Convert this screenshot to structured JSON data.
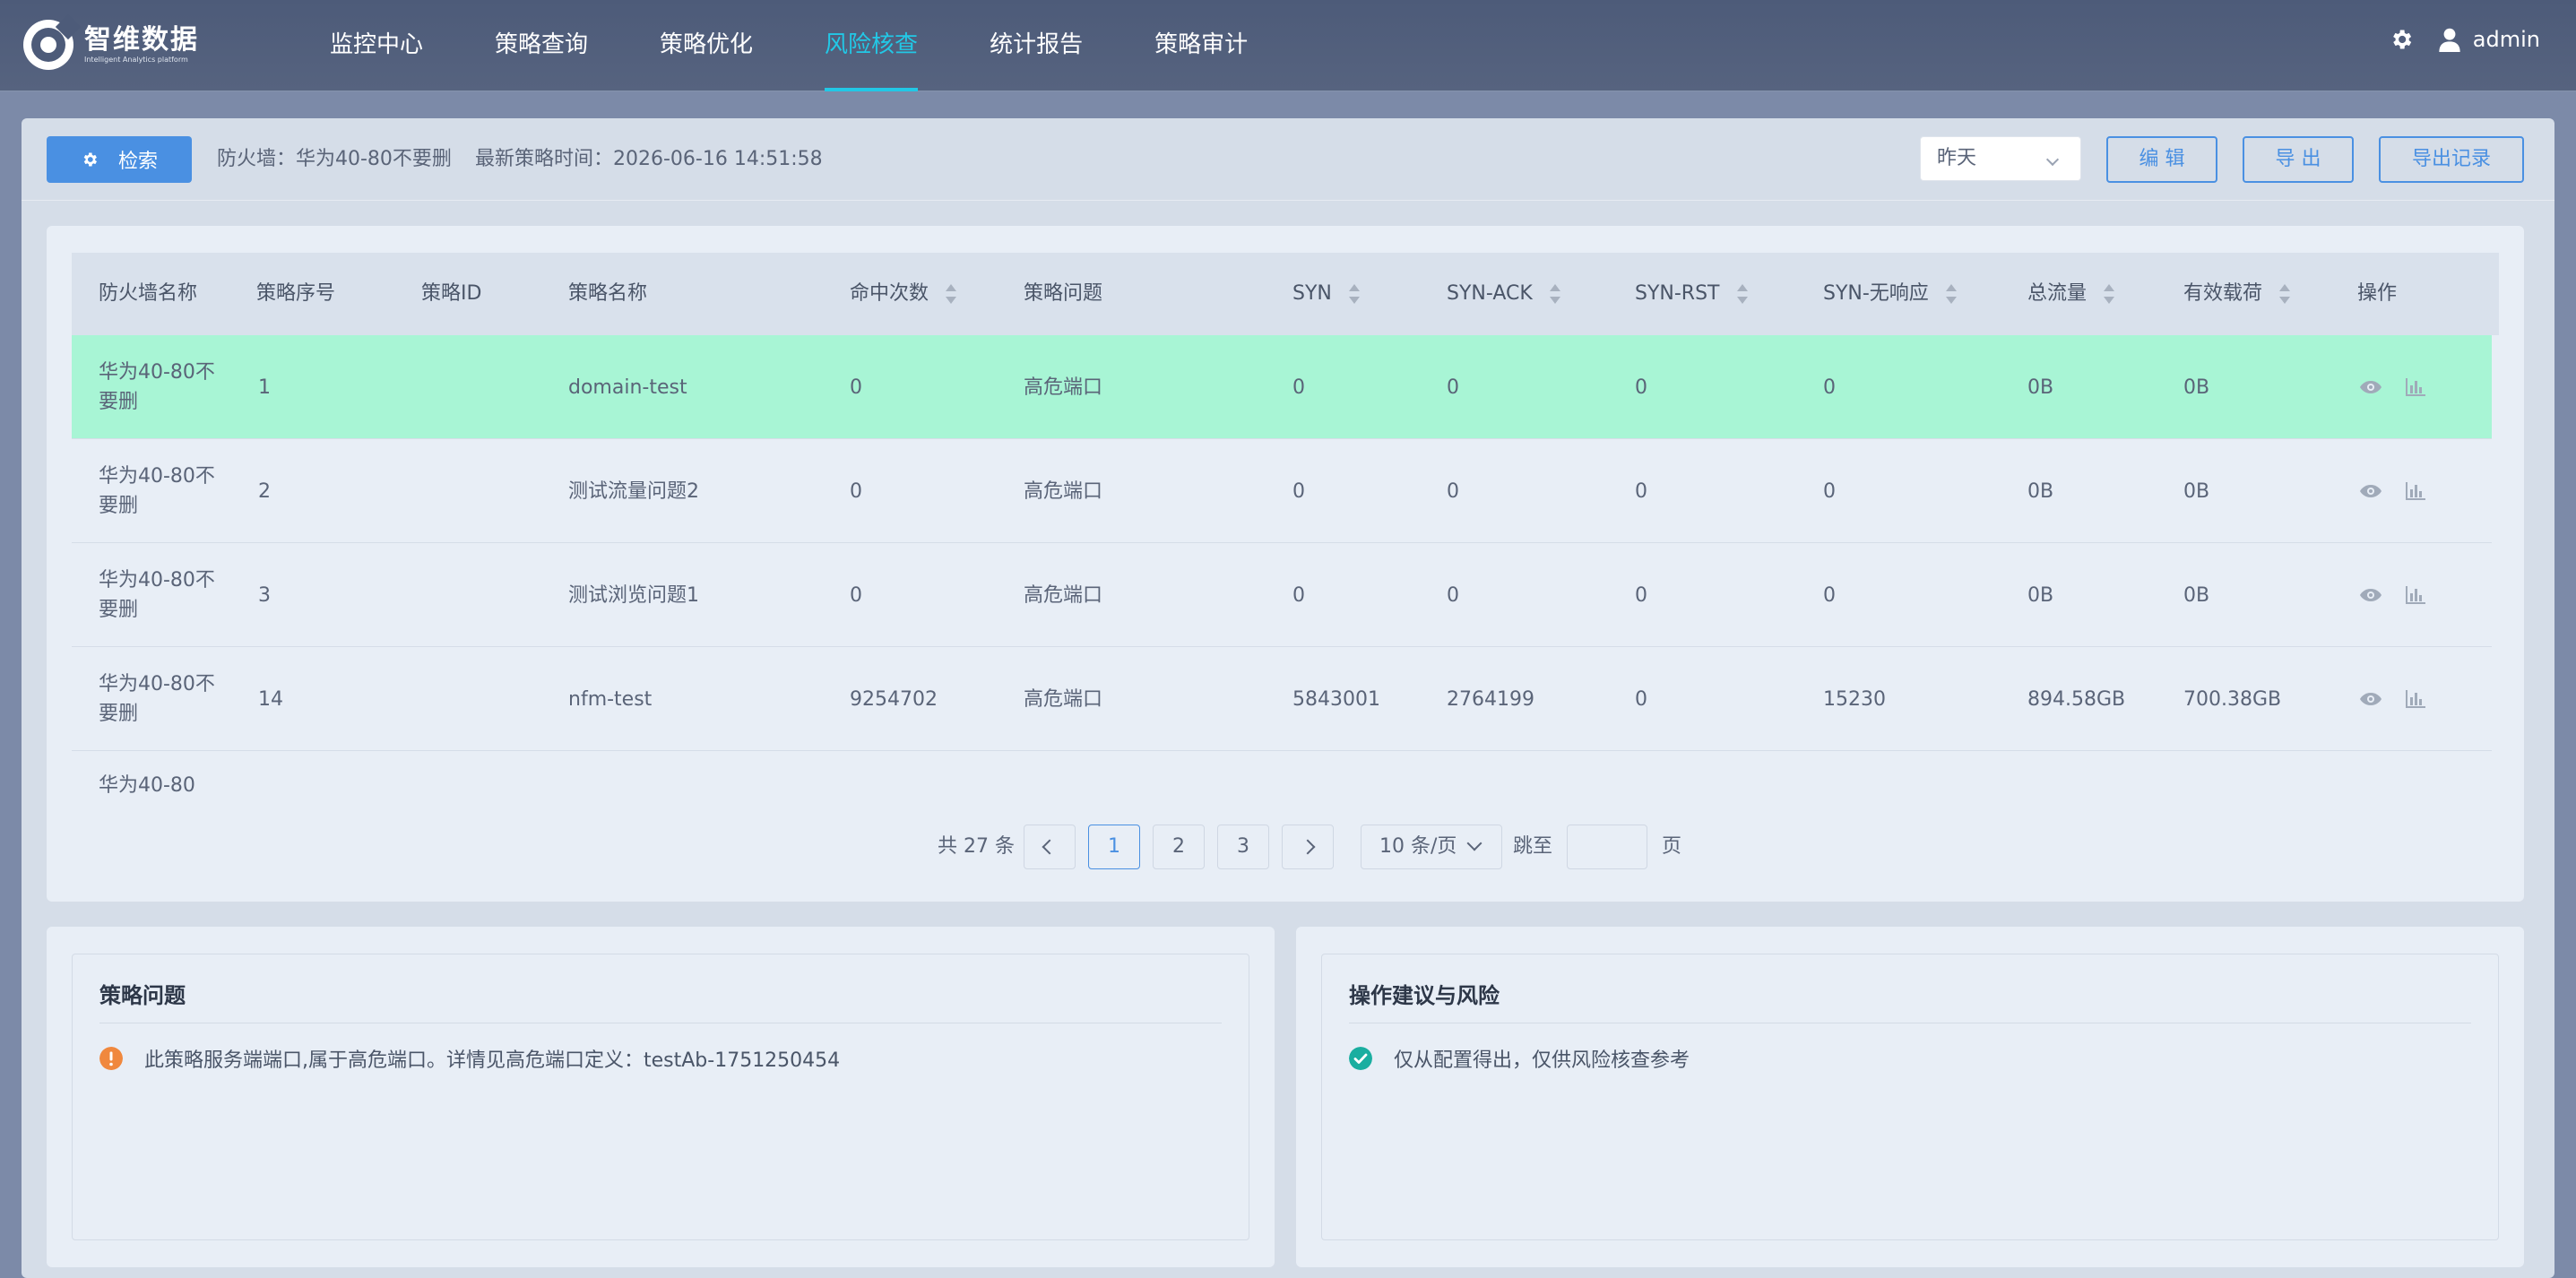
{
  "app": {
    "logo_name": "智维数据",
    "logo_sub": "Intelligent Analytics platform"
  },
  "nav": [
    {
      "label": "监控中心"
    },
    {
      "label": "策略查询"
    },
    {
      "label": "策略优化"
    },
    {
      "label": "风险核查",
      "active": true
    },
    {
      "label": "统计报告"
    },
    {
      "label": "策略审计"
    }
  ],
  "user": {
    "name": "admin"
  },
  "toolbar": {
    "search_label": "检索",
    "firewall_text": "防火墙：华为40-80不要删",
    "latest_time_text": "最新策略时间：2026-06-16 14:51:58",
    "date_select": "昨天",
    "edit_label": "编 辑",
    "export_label": "导 出",
    "export_log_label": "导出记录"
  },
  "table": {
    "headers": [
      "防火墙名称",
      "策略序号",
      "策略ID",
      "策略名称",
      "命中次数",
      "策略问题",
      "SYN",
      "SYN-ACK",
      "SYN-RST",
      "SYN-无响应",
      "总流量",
      "有效载荷",
      "操作"
    ],
    "rows": [
      {
        "fw": "华为40-80不要删",
        "seq": "1",
        "id": "",
        "name": "domain-test",
        "hits": "0",
        "issue": "高危端口",
        "syn": "0",
        "synack": "0",
        "synrst": "0",
        "synnr": "0",
        "total": "0B",
        "payload": "0B"
      },
      {
        "fw": "华为40-80不要删",
        "seq": "2",
        "id": "",
        "name": "测试流量问题2",
        "hits": "0",
        "issue": "高危端口",
        "syn": "0",
        "synack": "0",
        "synrst": "0",
        "synnr": "0",
        "total": "0B",
        "payload": "0B"
      },
      {
        "fw": "华为40-80不要删",
        "seq": "3",
        "id": "",
        "name": "测试浏览问题1",
        "hits": "0",
        "issue": "高危端口",
        "syn": "0",
        "synack": "0",
        "synrst": "0",
        "synnr": "0",
        "total": "0B",
        "payload": "0B"
      },
      {
        "fw": "华为40-80不要删",
        "seq": "14",
        "id": "",
        "name": "nfm-test",
        "hits": "9254702",
        "issue": "高危端口",
        "syn": "5843001",
        "synack": "2764199",
        "synrst": "0",
        "synnr": "15230",
        "total": "894.58GB",
        "payload": "700.38GB"
      },
      {
        "fw": "华为40-80",
        "seq": "",
        "id": "",
        "name": "",
        "hits": "",
        "issue": "",
        "syn": "",
        "synack": "",
        "synrst": "",
        "synnr": "",
        "total": "",
        "payload": ""
      }
    ]
  },
  "pagination": {
    "total_text": "共 27 条",
    "pages": [
      "1",
      "2",
      "3"
    ],
    "current": "1",
    "page_size": "10 条/页",
    "jump_label": "跳至",
    "page_suffix": "页"
  },
  "issue_panel": {
    "title": "策略问题",
    "text": "此策略服务端端口,属于高危端口。详情见高危端口定义：testAb-1751250454"
  },
  "advice_panel": {
    "title": "操作建议与风险",
    "text": "仅从配置得出，仅供风险核查参考"
  },
  "colors": {
    "accent": "#22c8e6",
    "primary": "#4a90e2",
    "selected_row": "#a8f5d5",
    "warning": "#f0883e",
    "success": "#1aaea0"
  }
}
